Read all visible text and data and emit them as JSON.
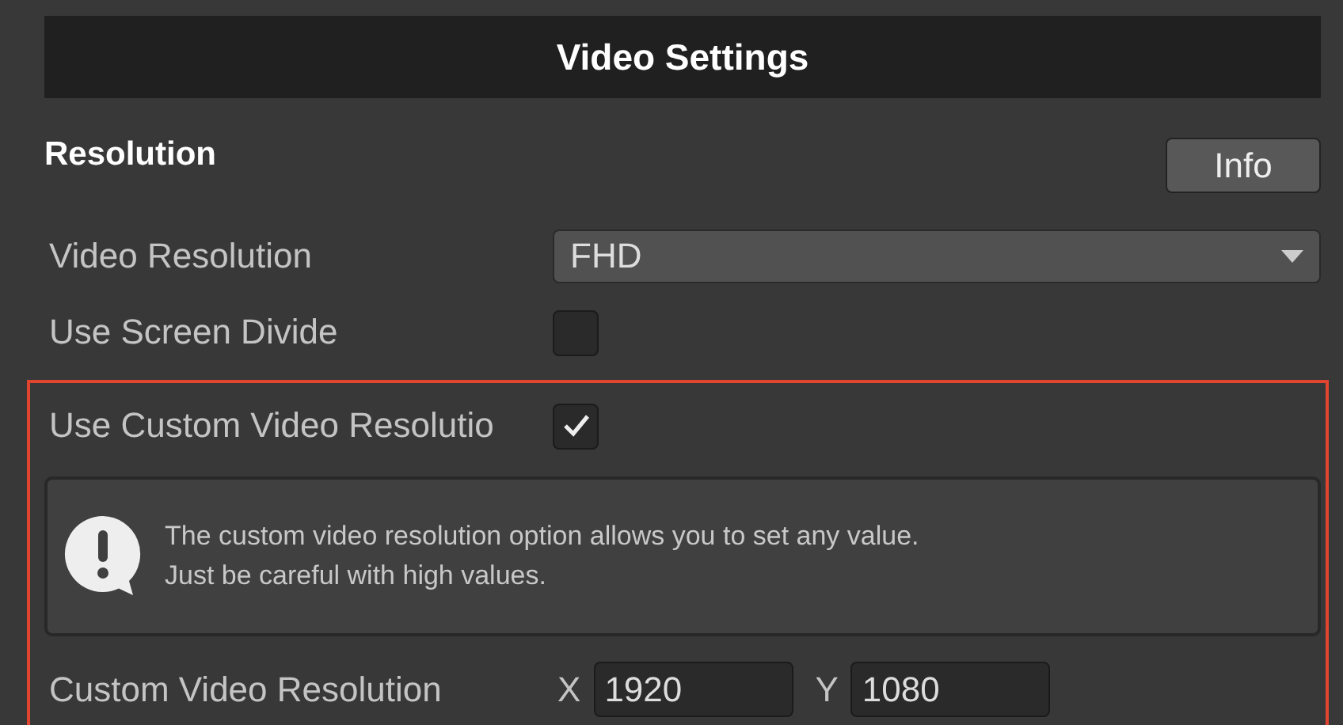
{
  "header": {
    "title": "Video Settings"
  },
  "section": {
    "title": "Resolution",
    "info_button": "Info"
  },
  "video_resolution": {
    "label": "Video Resolution",
    "value": "FHD"
  },
  "use_screen_divide": {
    "label": "Use Screen Divide",
    "checked": false
  },
  "highlighted_group": {
    "use_custom_resolution": {
      "label": "Use Custom Video Resolutio",
      "checked": true
    },
    "help_box": {
      "message": "The custom video resolution option allows you to set any value.\nJust be careful with high values."
    },
    "custom_resolution": {
      "label": "Custom Video Resolution",
      "x_label": "X",
      "x_value": "1920",
      "y_label": "Y",
      "y_value": "1080"
    }
  }
}
